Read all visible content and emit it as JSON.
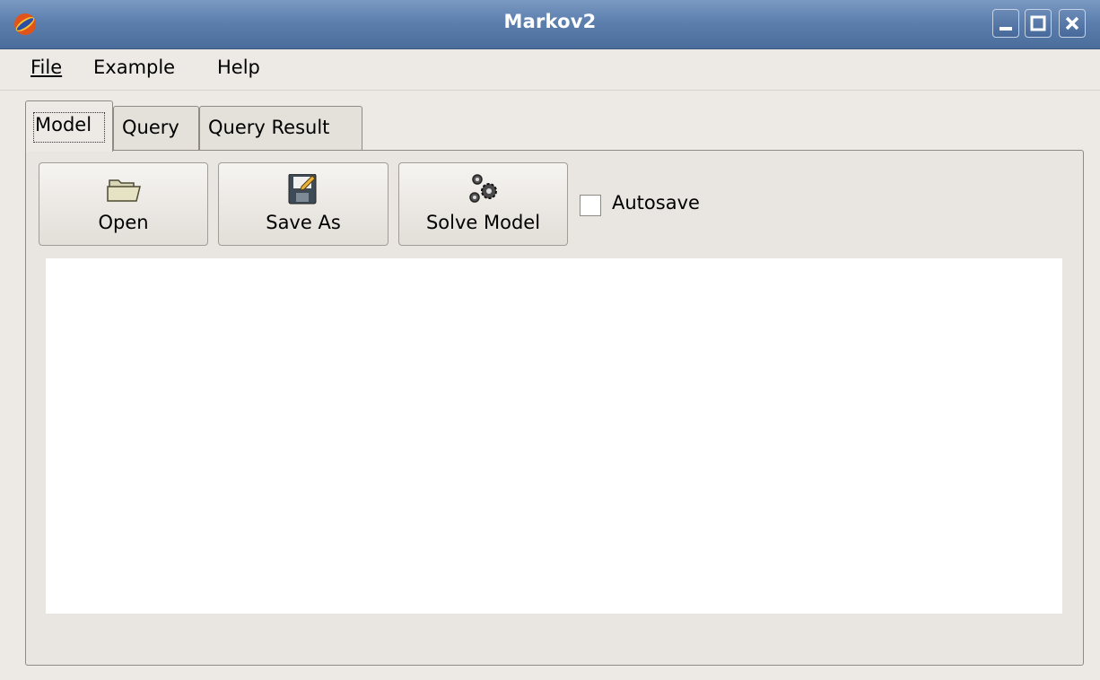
{
  "window": {
    "title": "Markov2"
  },
  "menu": {
    "file": "File",
    "example": "Example",
    "help": "Help"
  },
  "tabs": [
    {
      "label": "Model"
    },
    {
      "label": "Query"
    },
    {
      "label": "Query Result"
    }
  ],
  "toolbar": {
    "open_label": "Open",
    "save_as_label": "Save As",
    "solve_label": "Solve Model",
    "open_icon": "folder-open-icon",
    "save_icon": "floppy-save-icon",
    "solve_icon": "gears-icon"
  },
  "autosave": {
    "label": "Autosave",
    "checked": false
  },
  "editor": {
    "content": ""
  },
  "colors": {
    "titlebar": "#5c7fae",
    "background": "#edeae6"
  }
}
